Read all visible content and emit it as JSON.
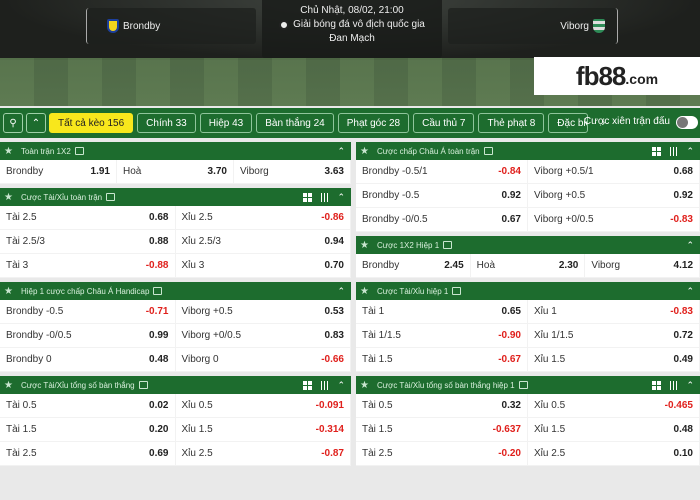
{
  "header": {
    "home_team": "Brondby",
    "away_team": "Viborg",
    "datetime": "Chủ Nhật, 08/02, 21:00",
    "league": "Giải bóng đá vô địch quốc gia",
    "country": "Đan Mạch",
    "logo_main": "fb88",
    "logo_domain": ".com"
  },
  "tabbar": {
    "tabs": [
      {
        "label": "Tất cả kèo 156"
      },
      {
        "label": "Chính 33"
      },
      {
        "label": "Hiệp 43"
      },
      {
        "label": "Bàn thắng 24"
      },
      {
        "label": "Phạt góc 28"
      },
      {
        "label": "Cầu thủ 7"
      },
      {
        "label": "Thẻ phạt 8"
      },
      {
        "label": "Đặc biệt"
      }
    ],
    "parlay_label": "Cược xiên trận đấu"
  },
  "left": [
    {
      "title": "Toàn trận 1X2",
      "icons": false,
      "rows": [
        [
          {
            "l": "Brondby",
            "o": "1.91"
          },
          {
            "l": "Hoà",
            "o": "3.70"
          },
          {
            "l": "Viborg",
            "o": "3.63"
          }
        ]
      ]
    },
    {
      "title": "Cược Tài/Xỉu toàn trận",
      "icons": true,
      "rows": [
        [
          {
            "l": "Tài 2.5",
            "o": "0.68"
          },
          {
            "l": "Xỉu 2.5",
            "o": "-0.86"
          }
        ],
        [
          {
            "l": "Tài 2.5/3",
            "o": "0.88"
          },
          {
            "l": "Xỉu 2.5/3",
            "o": "0.94"
          }
        ],
        [
          {
            "l": "Tài 3",
            "o": "-0.88"
          },
          {
            "l": "Xỉu 3",
            "o": "0.70"
          }
        ]
      ]
    },
    {
      "title": "Hiệp 1 cược chấp Châu Á Handicap",
      "icons": false,
      "rows": [
        [
          {
            "l": "Brondby -0.5",
            "o": "-0.71"
          },
          {
            "l": "Viborg +0.5",
            "o": "0.53"
          }
        ],
        [
          {
            "l": "Brondby -0/0.5",
            "o": "0.99"
          },
          {
            "l": "Viborg +0/0.5",
            "o": "0.83"
          }
        ],
        [
          {
            "l": "Brondby 0",
            "o": "0.48"
          },
          {
            "l": "Viborg 0",
            "o": "-0.66"
          }
        ]
      ]
    },
    {
      "title": "Cược Tài/Xỉu tổng số bàn thắng",
      "icons": true,
      "rows": [
        [
          {
            "l": "Tài 0.5",
            "o": "0.02"
          },
          {
            "l": "Xỉu 0.5",
            "o": "-0.091"
          }
        ],
        [
          {
            "l": "Tài 1.5",
            "o": "0.20"
          },
          {
            "l": "Xỉu 1.5",
            "o": "-0.314"
          }
        ],
        [
          {
            "l": "Tài 2.5",
            "o": "0.69"
          },
          {
            "l": "Xỉu 2.5",
            "o": "-0.87"
          }
        ]
      ]
    }
  ],
  "right": [
    {
      "title": "Cược chấp Châu Á toàn trận",
      "icons": true,
      "rows": [
        [
          {
            "l": "Brondby -0.5/1",
            "o": "-0.84"
          },
          {
            "l": "Viborg +0.5/1",
            "o": "0.68"
          }
        ],
        [
          {
            "l": "Brondby -0.5",
            "o": "0.92"
          },
          {
            "l": "Viborg +0.5",
            "o": "0.92"
          }
        ],
        [
          {
            "l": "Brondby -0/0.5",
            "o": "0.67"
          },
          {
            "l": "Viborg +0/0.5",
            "o": "-0.83"
          }
        ]
      ]
    },
    {
      "title": "Cược 1X2 Hiệp 1",
      "icons": false,
      "rows": [
        [
          {
            "l": "Brondby",
            "o": "2.45"
          },
          {
            "l": "Hoà",
            "o": "2.30"
          },
          {
            "l": "Viborg",
            "o": "4.12"
          }
        ]
      ]
    },
    {
      "title": "Cược Tài/Xỉu hiệp 1",
      "icons": false,
      "rows": [
        [
          {
            "l": "Tài 1",
            "o": "0.65"
          },
          {
            "l": "Xỉu 1",
            "o": "-0.83"
          }
        ],
        [
          {
            "l": "Tài 1/1.5",
            "o": "-0.90"
          },
          {
            "l": "Xỉu 1/1.5",
            "o": "0.72"
          }
        ],
        [
          {
            "l": "Tài 1.5",
            "o": "-0.67"
          },
          {
            "l": "Xỉu 1.5",
            "o": "0.49"
          }
        ]
      ]
    },
    {
      "title": "Cược Tài/Xỉu tổng số bàn thắng hiệp 1",
      "icons": true,
      "rows": [
        [
          {
            "l": "Tài 0.5",
            "o": "0.32"
          },
          {
            "l": "Xỉu 0.5",
            "o": "-0.465"
          }
        ],
        [
          {
            "l": "Tài 1.5",
            "o": "-0.637"
          },
          {
            "l": "Xỉu 1.5",
            "o": "0.48"
          }
        ],
        [
          {
            "l": "Tài 2.5",
            "o": "-0.20"
          },
          {
            "l": "Xỉu 2.5",
            "o": "0.10"
          }
        ]
      ]
    }
  ]
}
